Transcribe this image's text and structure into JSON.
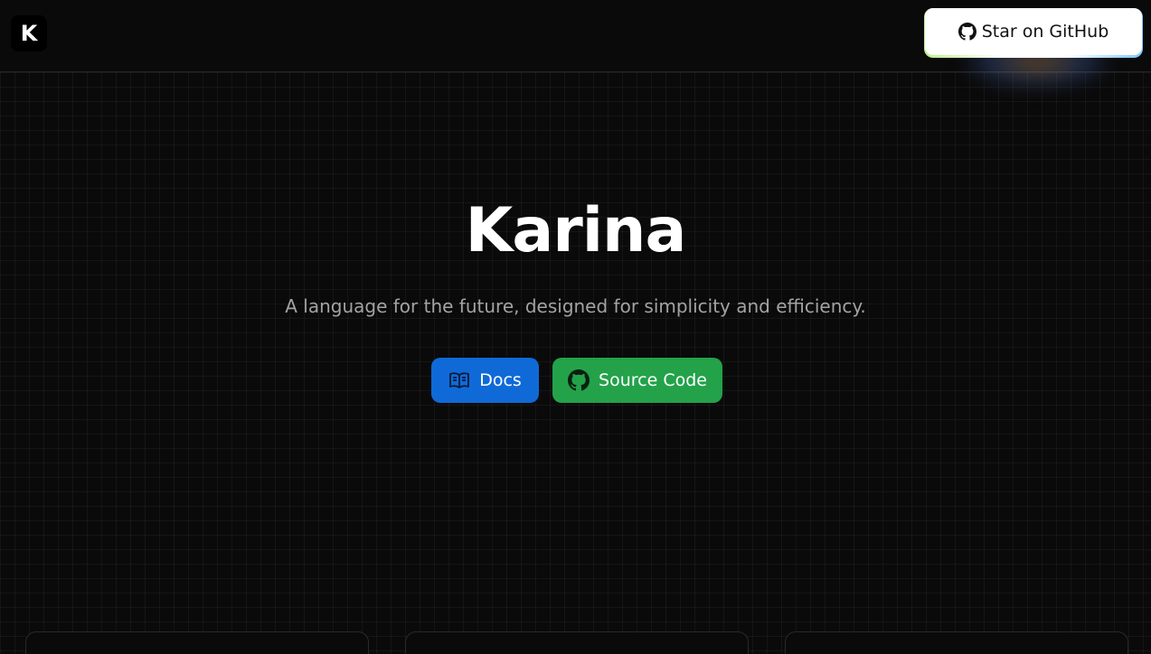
{
  "header": {
    "logo_letter": "K",
    "star_button_label": "Star on GitHub",
    "star_icon": "github-icon"
  },
  "hero": {
    "title": "Karina",
    "subtitle": "A language for the future, designed for simplicity and efficiency."
  },
  "actions": {
    "docs_label": "Docs",
    "docs_icon": "book-open-icon",
    "source_label": "Source Code",
    "source_icon": "github-icon"
  },
  "colors": {
    "background": "#0a0a0a",
    "docs_button": "#0f6ad8",
    "source_button": "#23a24a",
    "subtitle_text": "#a3a3a3"
  }
}
